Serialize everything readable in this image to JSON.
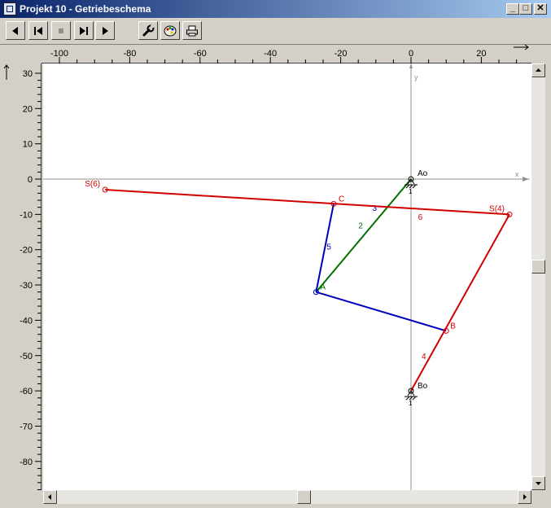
{
  "window": {
    "title": "Projekt 10 - Getriebeschema",
    "minimize": "_",
    "maximize": "□",
    "close": "✕"
  },
  "toolbar": {
    "buttons": [
      {
        "name": "rewind",
        "icon": "play-backward-icon"
      },
      {
        "name": "first-frame",
        "icon": "skip-start-icon"
      },
      {
        "name": "stop",
        "icon": "stop-icon"
      },
      {
        "name": "last-frame",
        "icon": "skip-end-icon"
      },
      {
        "name": "play",
        "icon": "play-forward-icon"
      },
      {
        "name": "settings",
        "icon": "wrench-icon"
      },
      {
        "name": "colors",
        "icon": "palette-icon"
      },
      {
        "name": "print",
        "icon": "printer-icon"
      }
    ]
  },
  "rulers": {
    "x_ticks": [
      "-100",
      "-80",
      "-60",
      "-40",
      "-20",
      "0",
      "20"
    ],
    "y_ticks": [
      "30",
      "20",
      "10",
      "0",
      "-10",
      "-20",
      "-30",
      "-40",
      "-50",
      "-60",
      "-70",
      "-80"
    ]
  },
  "axes": {
    "x_label": "x",
    "y_label": "y",
    "x_range": [
      -105,
      33
    ],
    "y_range": [
      -90,
      32
    ]
  },
  "mechanism": {
    "joints": [
      {
        "id": "Ao",
        "label": "Ao",
        "x": 0,
        "y": 0,
        "fixed": true
      },
      {
        "id": "Bo",
        "label": "Bo",
        "x": 0,
        "y": -60,
        "fixed": true
      },
      {
        "id": "A",
        "label": "A",
        "x": -27,
        "y": -32
      },
      {
        "id": "B",
        "label": "B",
        "x": 10,
        "y": -43
      },
      {
        "id": "C",
        "label": "C",
        "x": -22,
        "y": -7
      },
      {
        "id": "S4",
        "label": "S(4)",
        "x": 28,
        "y": -10
      },
      {
        "id": "S6",
        "label": "S(6)",
        "x": -87,
        "y": -3
      }
    ],
    "links": [
      {
        "label": "2",
        "from": "Ao",
        "to": "A",
        "color": "#007000"
      },
      {
        "label": "3",
        "from": "A",
        "to": "B",
        "color": "#0000c0"
      },
      {
        "label": "5",
        "from": "A",
        "to": "C",
        "color": "#0000c0"
      },
      {
        "label": "4",
        "from": "Bo",
        "to": "S4",
        "color": "#d00000"
      },
      {
        "label": "6",
        "from": "S6",
        "to": "S4",
        "color": "#d00000"
      }
    ],
    "frame_labels": [
      "1",
      "1"
    ]
  }
}
